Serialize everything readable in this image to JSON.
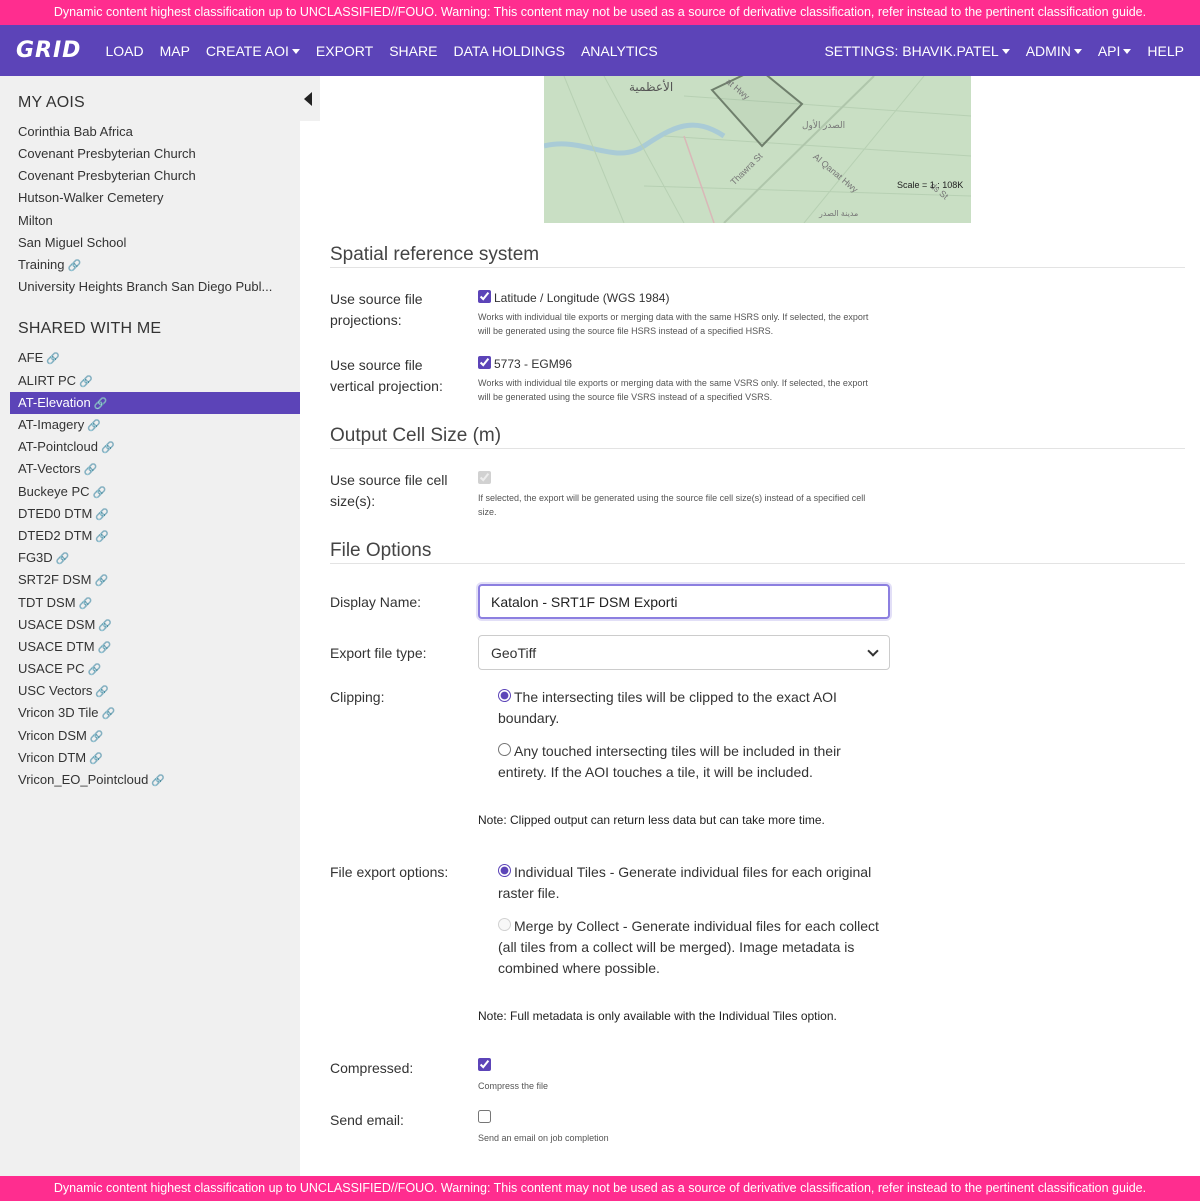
{
  "banner": {
    "text": "Dynamic content highest classification up to UNCLASSIFIED//FOUO. Warning: This content may not be used as a source of derivative classification, refer instead to the pertinent classification guide.",
    "color": "#ff2d8f"
  },
  "navbar": {
    "logo": "GRID",
    "color": "#5c44b8",
    "left_items": [
      "LOAD",
      "MAP",
      "CREATE AOI",
      "EXPORT",
      "SHARE",
      "DATA HOLDINGS",
      "ANALYTICS"
    ],
    "right_items": [
      "SETTINGS: BHAVIK.PATEL",
      "ADMIN",
      "API",
      "HELP"
    ]
  },
  "sidebar": {
    "my_aois_heading": "MY AOIS",
    "my_aois": [
      "Corinthia Bab Africa",
      "Covenant Presbyterian Church",
      "Covenant Presbyterian Church",
      "Hutson-Walker Cemetery",
      "Milton",
      "San Miguel School",
      "Training",
      "University Heights Branch San Diego Publ..."
    ],
    "shared_heading": "SHARED WITH ME",
    "shared": [
      "AFE",
      "ALIRT PC",
      "AT-Elevation",
      "AT-Imagery",
      "AT-Pointcloud",
      "AT-Vectors",
      "Buckeye PC",
      "DTED0 DTM",
      "DTED2 DTM",
      "FG3D",
      "SRT2F DSM",
      "TDT DSM",
      "USACE DSM",
      "USACE DTM",
      "USACE PC",
      "USC Vectors",
      "Vricon 3D Tile",
      "Vricon DSM",
      "Vricon DTM",
      "Vricon_EO_Pointcloud"
    ],
    "active_item": "AT-Elevation"
  },
  "map": {
    "scale": "Scale = 1 : 108K",
    "labels": [
      "الأعظمية",
      "at Hwy",
      "الصدر الأول",
      "Thawra St",
      "Al Qanat Hwy",
      "مدينة الصدر",
      "ds St"
    ]
  },
  "srs": {
    "title": "Spatial reference system",
    "source_proj_label": "Use source file projections:",
    "source_proj_value": "Latitude / Longitude (WGS 1984)",
    "source_proj_help": "Works with individual tile exports or merging data with the same HSRS only. If selected, the export will be generated using the source file HSRS instead of a specified HSRS.",
    "source_proj_checked": true,
    "vert_label": "Use source file vertical projection:",
    "vert_value": "5773 - EGM96",
    "vert_help": "Works with individual tile exports or merging data with the same VSRS only. If selected, the export will be generated using the source file VSRS instead of a specified VSRS.",
    "vert_checked": true
  },
  "cell_size": {
    "title": "Output Cell Size (m)",
    "label": "Use source file cell size(s):",
    "help": "If selected, the export will be generated using the source file cell size(s) instead of a specified cell size.",
    "checked": true,
    "disabled": true
  },
  "file_options": {
    "title": "File Options",
    "display_name_label": "Display Name:",
    "display_name_value": "Katalon - SRT1F DSM Exporti",
    "export_type_label": "Export file type:",
    "export_type_value": "GeoTiff",
    "clipping_label": "Clipping:",
    "clipping_options": [
      "The intersecting tiles will be clipped to the exact AOI boundary.",
      "Any touched intersecting tiles will be included in their entirety. If the AOI touches a tile, it will be included."
    ],
    "clipping_selected": 0,
    "clipping_note": "Note: Clipped output can return less data but can take more time.",
    "export_options_label": "File export options:",
    "export_options": [
      "Individual Tiles - Generate individual files for each original raster file.",
      "Merge by Collect - Generate individual files for each collect (all tiles from a collect will be merged). Image metadata is combined where possible."
    ],
    "export_selected": 0,
    "export_note": "Note: Full metadata is only available with the Individual Tiles option.",
    "compressed_label": "Compressed:",
    "compressed_help": "Compress the file",
    "compressed_checked": true,
    "email_label": "Send email:",
    "email_help": "Send an email on job completion",
    "email_checked": false
  }
}
